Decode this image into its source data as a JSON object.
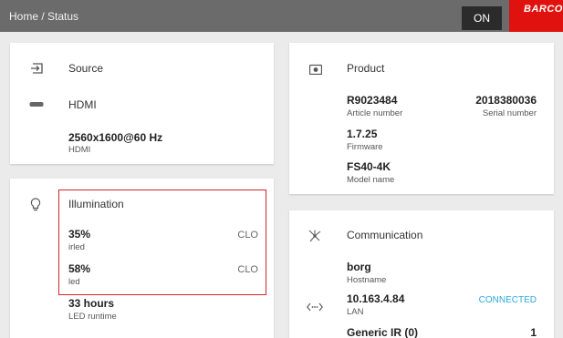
{
  "header": {
    "breadcrumb": "Home / Status",
    "power_label": "ON",
    "logo_text": "BARCO",
    "brand_color": "#e0120f"
  },
  "source": {
    "icon": "input-icon",
    "title": "Source",
    "connector_icon": "hdmi-icon",
    "connector": "HDMI",
    "resolution": "2560x1600@60 Hz",
    "resolution_sub": "HDMI"
  },
  "illumination": {
    "icon": "bulb-icon",
    "title": "Illumination",
    "rows": [
      {
        "value": "35%",
        "label": "irled",
        "mode": "CLO"
      },
      {
        "value": "58%",
        "label": "led",
        "mode": "CLO"
      }
    ],
    "runtime": "33 hours",
    "runtime_label": "LED runtime",
    "highlight_color": "#d3252b"
  },
  "product": {
    "icon": "camera-icon",
    "title": "Product",
    "article_number": "R9023484",
    "article_label": "Article number",
    "serial_number": "2018380036",
    "serial_label": "Serial number",
    "firmware": "1.7.25",
    "firmware_label": "Firmware",
    "model": "FS40-4K",
    "model_label": "Model name"
  },
  "communication": {
    "icon": "network-icon",
    "title": "Communication",
    "hostname": "borg",
    "hostname_label": "Hostname",
    "lan_icon": "lan-icon",
    "ip": "10.163.4.84",
    "ip_label": "LAN",
    "lan_status": "CONNECTED",
    "lan_status_color": "#2aa9dd",
    "ir_label": "Generic IR (0)",
    "ir_value": "1"
  }
}
